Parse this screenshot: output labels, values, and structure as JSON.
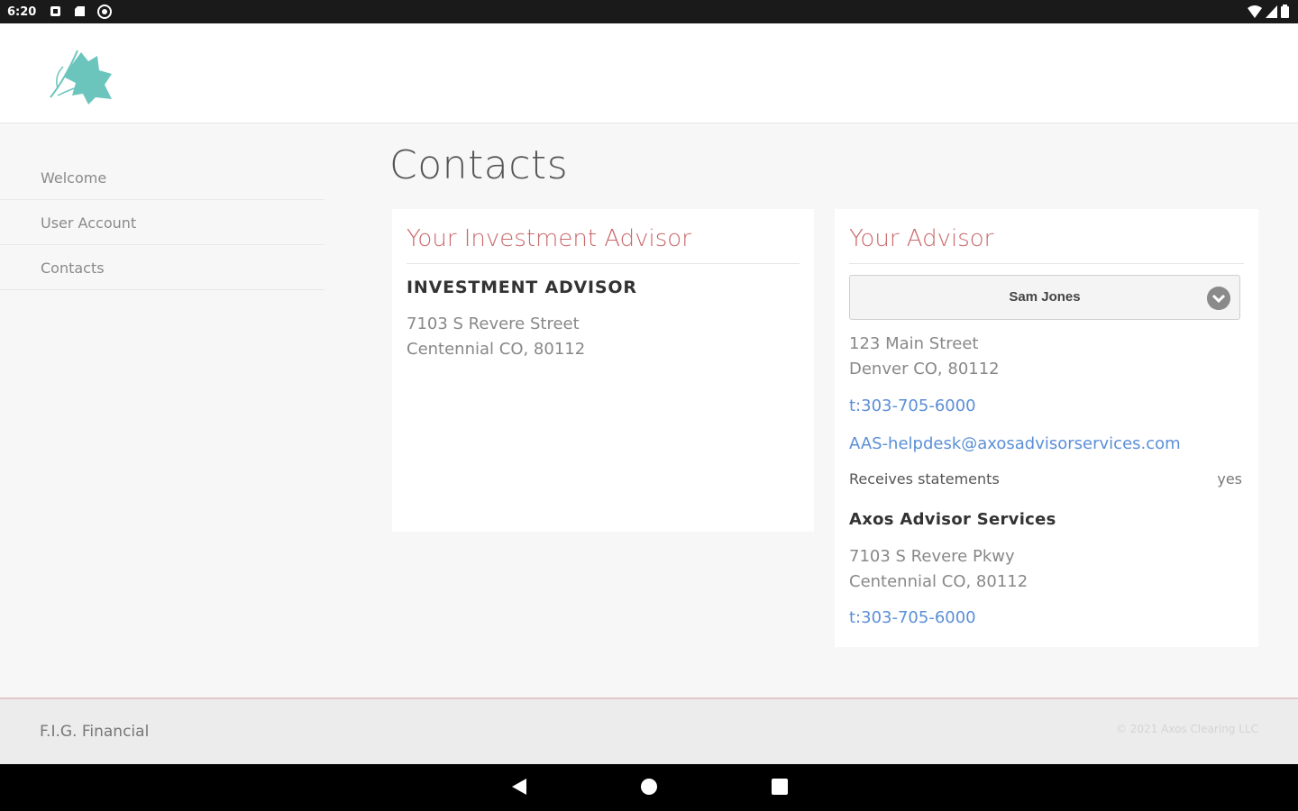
{
  "statusbar": {
    "time": "6:20",
    "left_icons": [
      "notification-icon",
      "sd-card-icon",
      "vpn-icon"
    ],
    "right_icons": [
      "wifi-icon",
      "signal-icon",
      "battery-icon"
    ]
  },
  "header": {
    "logo": "leaf-logo-icon",
    "brand_color": "#6cc5bd"
  },
  "sidebar": {
    "items": [
      {
        "label": "Welcome"
      },
      {
        "label": "User Account"
      },
      {
        "label": "Contacts"
      }
    ]
  },
  "main": {
    "title": "Contacts",
    "investment_advisor": {
      "heading": "Your Investment Advisor",
      "name": "INVESTMENT ADVISOR",
      "address_line1": "7103 S Revere Street",
      "address_line2": "Centennial CO, 80112"
    },
    "advisor": {
      "heading": "Your Advisor",
      "selected": "Sam Jones",
      "address_line1": "123 Main Street",
      "address_line2": "Denver CO, 80112",
      "phone": "t:303-705-6000",
      "email": "AAS-helpdesk@axosadvisorservices.com",
      "statements_label": "Receives statements",
      "statements_value": "yes",
      "firm_name": "Axos Advisor Services",
      "firm_address_line1": "7103 S Revere Pkwy",
      "firm_address_line2": "Centennial CO, 80112",
      "firm_phone": "t:303-705-6000"
    }
  },
  "footer": {
    "brand": "F.I.G. Financial",
    "copyright": "© 2021 Axos Clearing LLC"
  },
  "colors": {
    "accent": "#c9686a",
    "link": "#5b8fd6",
    "logo": "#6cc5bd"
  },
  "navbar": {
    "buttons": [
      "back-icon",
      "home-icon",
      "recents-icon"
    ]
  }
}
